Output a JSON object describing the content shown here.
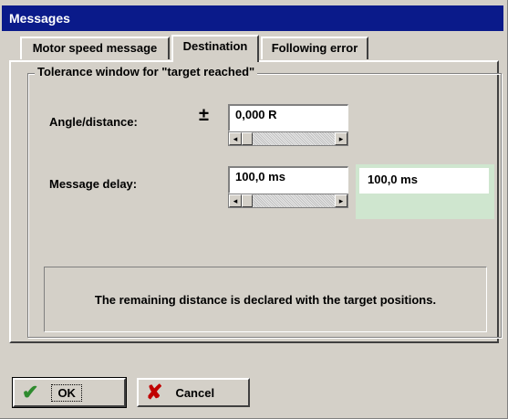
{
  "window": {
    "title": "Messages"
  },
  "tabs": [
    {
      "label": "Motor speed message",
      "active": false
    },
    {
      "label": "Destination",
      "active": true
    },
    {
      "label": "Following error",
      "active": false
    }
  ],
  "group": {
    "title": "Tolerance window for \"target reached\""
  },
  "angle": {
    "label": "Angle/distance:",
    "sign": "±",
    "value": "0,000  R"
  },
  "delay": {
    "label": "Message delay:",
    "value": "100,0 ms",
    "readout": "100,0 ms"
  },
  "info": {
    "text": "The remaining distance is declared with the target positions."
  },
  "buttons": {
    "ok_label": "OK",
    "cancel_label": "Cancel"
  },
  "icons": {
    "ok": "check-icon",
    "cancel": "x-icon",
    "scroll_left": "arrow-left-icon",
    "scroll_right": "arrow-right-icon"
  },
  "colors": {
    "title_bar": "#0a1a8a",
    "face": "#d4d0c8",
    "readout_bg": "#cfe6cf",
    "ok_check": "#2e8b2e",
    "cancel_x": "#c00000"
  }
}
